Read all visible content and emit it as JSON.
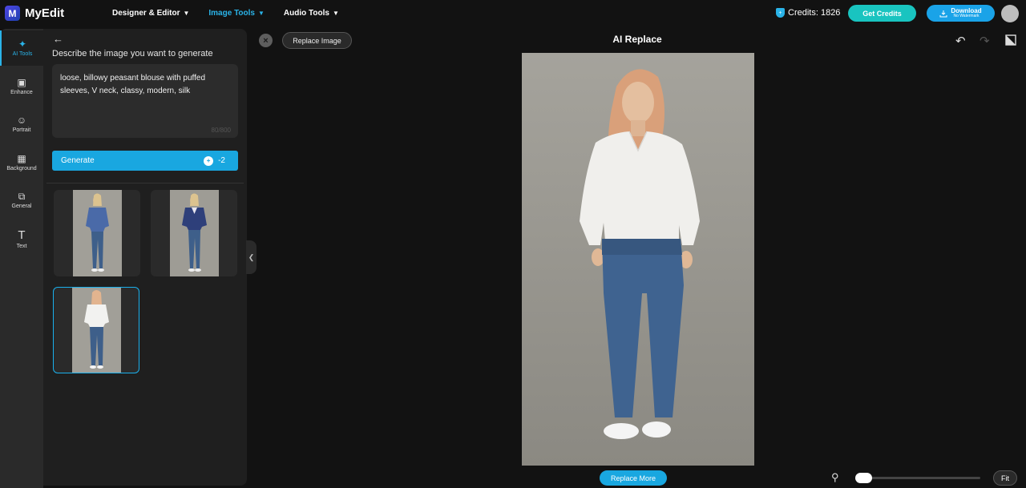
{
  "app": {
    "name": "MyEdit",
    "logo_letter": "M"
  },
  "topnav": [
    {
      "label": "Designer & Editor",
      "active": false
    },
    {
      "label": "Image Tools",
      "active": true
    },
    {
      "label": "Audio Tools",
      "active": false
    }
  ],
  "account": {
    "credits_label": "Credits: 1826",
    "get_credits_label": "Get Credits",
    "download_label": "Download",
    "download_sub": "No Watermark"
  },
  "rail": [
    {
      "label": "AI Tools",
      "icon": "magic-wand-icon",
      "active": true
    },
    {
      "label": "Enhance",
      "icon": "enhance-icon",
      "active": false
    },
    {
      "label": "Portrait",
      "icon": "portrait-icon",
      "active": false
    },
    {
      "label": "Background",
      "icon": "background-icon",
      "active": false
    },
    {
      "label": "General",
      "icon": "crop-icon",
      "active": false
    },
    {
      "label": "Text",
      "icon": "text-icon",
      "active": false
    }
  ],
  "panel": {
    "title": "Describe the image you want to generate",
    "prompt": "loose, billowy peasant blouse with puffed sleeves, V neck, classy, modern, silk",
    "char_count": "80/800",
    "generate_label": "Generate",
    "generate_cost": "-2"
  },
  "results": [
    {
      "label": "result-1",
      "shirt": "#4a6aa8",
      "selected": false
    },
    {
      "label": "result-2",
      "shirt": "#2e3f7a",
      "selected": false
    },
    {
      "label": "result-3",
      "shirt": "#f2f2f0",
      "selected": true
    }
  ],
  "canvas": {
    "title": "AI Replace",
    "replace_image_label": "Replace Image",
    "replace_more_label": "Replace More",
    "fit_label": "Fit",
    "zoom_level": 0.05
  },
  "colors": {
    "accent": "#1aa3e8",
    "teal": "#19c4c0",
    "background": "#121212"
  }
}
